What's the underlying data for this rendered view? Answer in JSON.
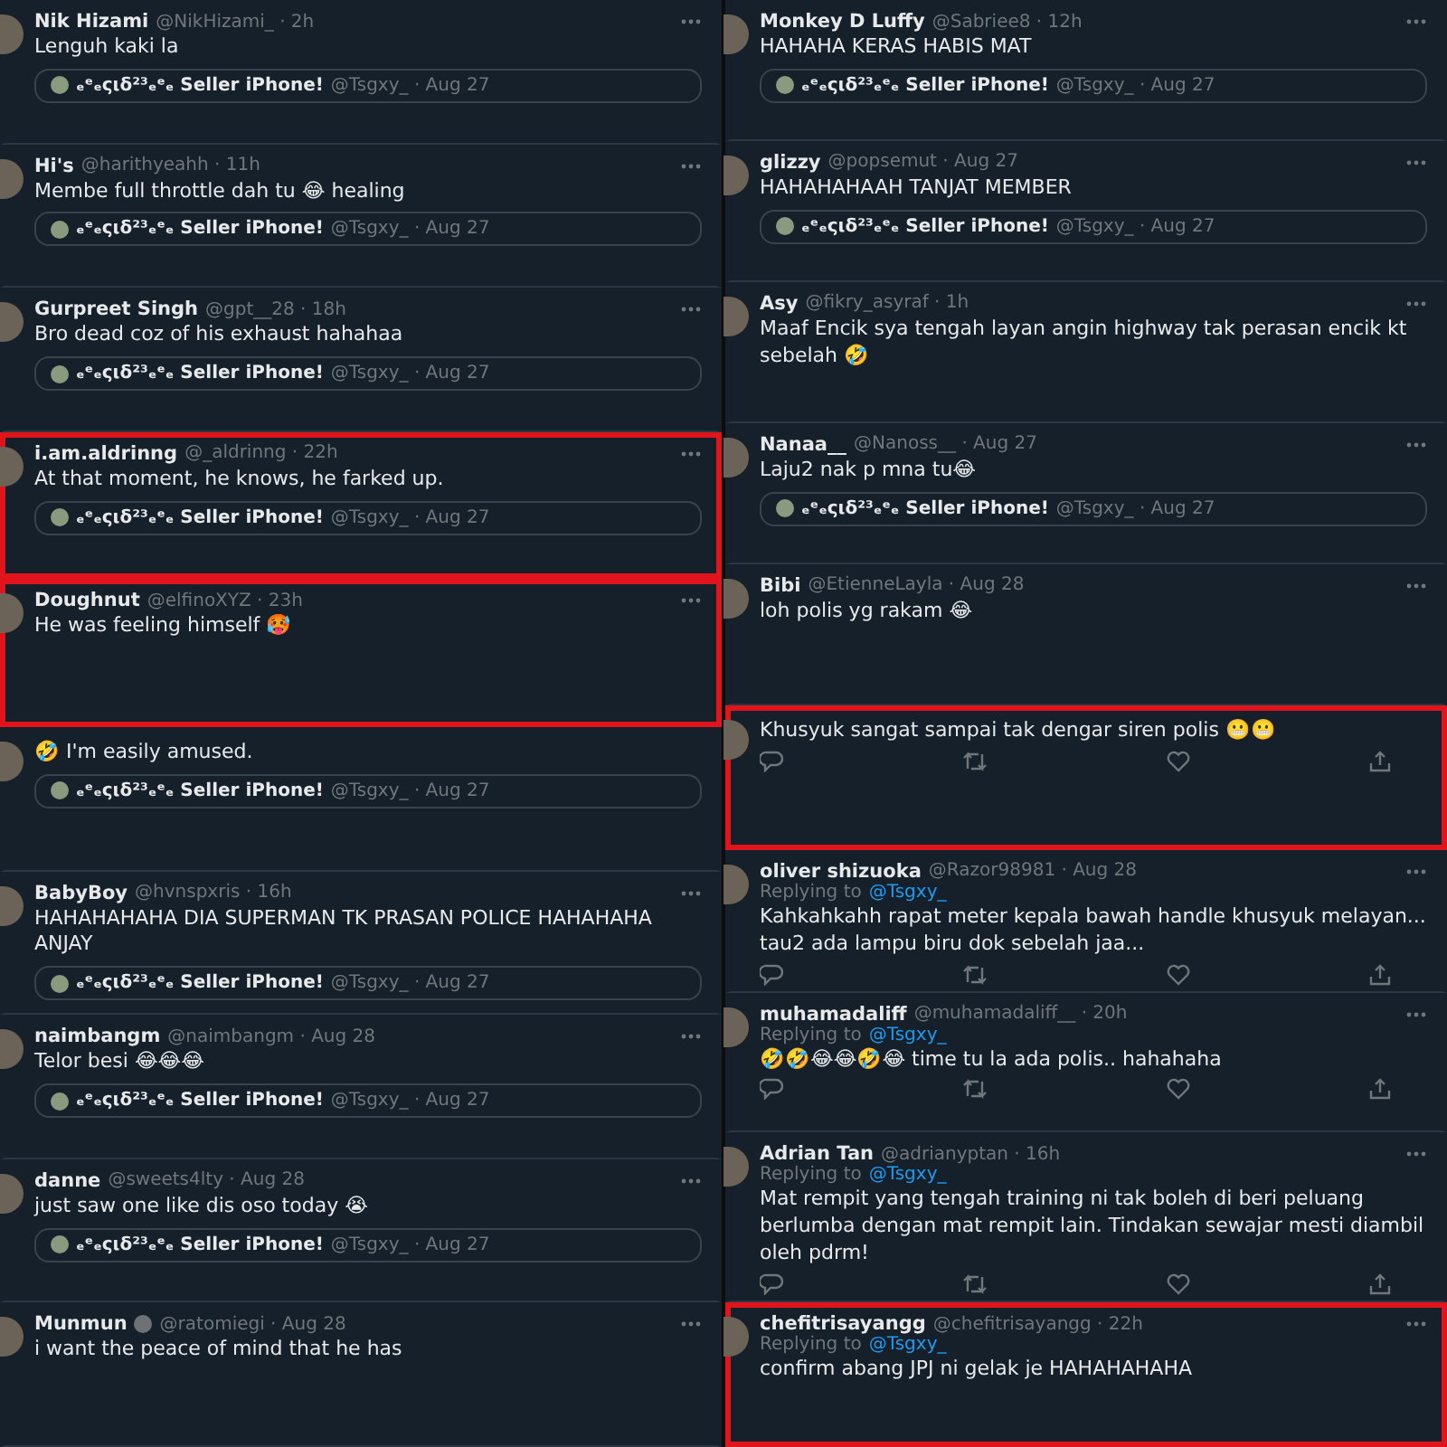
{
  "columns": [
    {
      "tweets": [
        {
          "name": "Nik Hizami",
          "meta": "@NikHizami_ · 2h",
          "text": "Lenguh kaki la",
          "quote": {
            "name": "ₑᵉₑςιδ²³ₑᵉₑ Seller iPhone!",
            "meta": "@Tsgxy_ · Aug 27"
          },
          "highlighted": false
        },
        {
          "name": "Hi's",
          "meta": "@harithyeahh · 11h",
          "text": "Membe full throttle dah tu 😂 healing",
          "quote": {
            "name": "ₑᵉₑςιδ²³ₑᵉₑ Seller iPhone!",
            "meta": "@Tsgxy_ · Aug 27"
          },
          "highlighted": false
        },
        {
          "name": "Gurpreet Singh",
          "meta": "@gpt__28 · 18h",
          "text": "Bro dead coz of his exhaust hahahaa",
          "quote": {
            "name": "ₑᵉₑςιδ²³ₑᵉₑ Seller iPhone!",
            "meta": "@Tsgxy_ · Aug 27"
          },
          "highlighted": false
        },
        {
          "name": "i.am.aldrinng",
          "meta": "@_aldrinng · 22h",
          "text": "At that moment, he knows, he farked up.",
          "quote": {
            "name": "ₑᵉₑςιδ²³ₑᵉₑ Seller iPhone!",
            "meta": "@Tsgxy_ · Aug 27"
          },
          "highlighted": true
        },
        {
          "name": "Doughnut",
          "meta": "@elfinoXYZ · 23h",
          "text": "He was feeling himself 🥵",
          "highlighted": true
        },
        {
          "text": "🤣 I'm easily amused.",
          "quote": {
            "name": "ₑᵉₑςιδ²³ₑᵉₑ Seller iPhone!",
            "meta": "@Tsgxy_ · Aug 27"
          },
          "highlighted": false
        },
        {
          "name": "BabyBoy",
          "meta": "@hvnspxris · 16h",
          "text": "HAHAHAHAHA DIA SUPERMAN TK PRASAN POLICE HAHAHAHA ANJAY",
          "quote": {
            "name": "ₑᵉₑςιδ²³ₑᵉₑ Seller iPhone!",
            "meta": "@Tsgxy_ · Aug 27"
          },
          "highlighted": false
        },
        {
          "name": "naimbangm",
          "meta": "@naimbangm · Aug 28",
          "text": "Telor besi 😂😂😂",
          "quote": {
            "name": "ₑᵉₑςιδ²³ₑᵉₑ Seller iPhone!",
            "meta": "@Tsgxy_ · Aug 27"
          },
          "highlighted": false
        },
        {
          "name": "danne",
          "meta": "@sweets4lty · Aug 28",
          "text": "just saw one like dis oso today 😭",
          "quote": {
            "name": "ₑᵉₑςιδ²³ₑᵉₑ Seller iPhone!",
            "meta": "@Tsgxy_ · Aug 27"
          },
          "highlighted": false
        },
        {
          "name": "Munmun",
          "badge": true,
          "meta": "@ratomiegi · Aug 28",
          "text": "i want the peace of mind that he has",
          "highlighted": false
        }
      ]
    },
    {
      "tweets": [
        {
          "name": "Monkey D Luffy",
          "meta": "@Sabriee8 · 12h",
          "text": "HAHAHA KERAS HABIS MAT",
          "quote": {
            "name": "ₑᵉₑςιδ²³ₑᵉₑ Seller iPhone!",
            "meta": "@Tsgxy_ · Aug 27"
          },
          "highlighted": false
        },
        {
          "name": "glizzy",
          "meta": "@popsemut · Aug 27",
          "text": "HAHAHAHAAH TANJAT MEMBER",
          "quote": {
            "name": "ₑᵉₑςιδ²³ₑᵉₑ Seller iPhone!",
            "meta": "@Tsgxy_ · Aug 27"
          },
          "highlighted": false
        },
        {
          "name": "Asy",
          "meta": "@fikry_asyraf · 1h",
          "text": "Maaf Encik sya tengah layan angin highway tak perasan encik kt sebelah 🤣",
          "highlighted": false
        },
        {
          "name": "Nanaa__",
          "meta": "@Nanoss__ · Aug 27",
          "text": "Laju2 nak p mna tu😂",
          "quote": {
            "name": "ₑᵉₑςιδ²³ₑᵉₑ Seller iPhone!",
            "meta": "@Tsgxy_ · Aug 27"
          },
          "highlighted": false
        },
        {
          "name": "Bibi",
          "meta": "@EtienneLayla · Aug 28",
          "text": "loh polis yg rakam 😂",
          "highlighted": false
        },
        {
          "text": "Khusyuk sangat sampai tak dengar siren polis 😬😬",
          "actions": true,
          "highlighted": true
        },
        {
          "name": "oliver shizuoka",
          "meta": "@Razor98981 · Aug 28",
          "replying": {
            "label": "Replying to",
            "handle": "@Tsgxy_"
          },
          "text": "Kahkahkahh rapat meter kepala bawah handle khusyuk melayan... tau2 ada lampu biru dok sebelah jaa...",
          "actions": true,
          "highlighted": false
        },
        {
          "name": "muhamadaliff",
          "meta": "@muhamadaliff__ · 20h",
          "replying": {
            "label": "Replying to",
            "handle": "@Tsgxy_"
          },
          "text": "🤣🤣😂😂🤣😂 time tu la ada polis.. hahahaha",
          "actions": true,
          "highlighted": false
        },
        {
          "name": "Adrian Tan",
          "meta": "@adrianyptan · 16h",
          "replying": {
            "label": "Replying to",
            "handle": "@Tsgxy_"
          },
          "text": "Mat rempit yang tengah training ni tak boleh di beri peluang berlumba dengan mat rempit lain. Tindakan sewajar mesti diambil oleh pdrm!",
          "actions": true,
          "highlighted": false
        },
        {
          "name": "chefitrisayangg",
          "meta": "@chefitrisayangg · 22h",
          "replying": {
            "label": "Replying to",
            "handle": "@Tsgxy_"
          },
          "text": "confirm abang JPJ ni gelak je HAHAHAHAHA",
          "highlighted": true
        }
      ]
    }
  ]
}
